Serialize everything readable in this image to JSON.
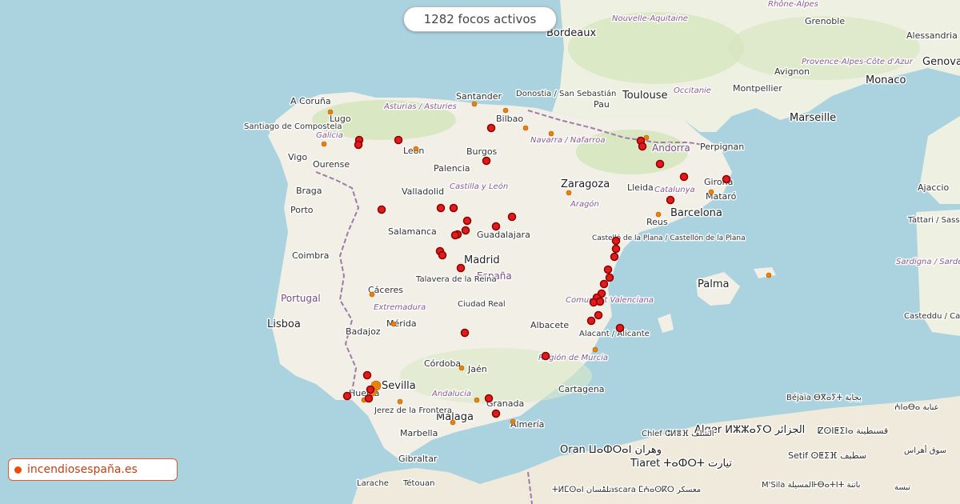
{
  "counter": {
    "text": "1282 focos activos"
  },
  "brand": {
    "label": "incendiosespaña.es",
    "color": "#f04a0a"
  },
  "colors": {
    "sea": "#aad3df",
    "land": "#f2efe9",
    "fire_fill": "#e01b1b",
    "fire_stroke": "#8b0000",
    "small_fire": "#e8820c",
    "border": "#9e7ba8"
  },
  "labels": {
    "countries": [
      {
        "id": "country-espana",
        "text": "España"
      },
      {
        "id": "country-portugal",
        "text": "Portugal"
      },
      {
        "id": "country-andorra",
        "text": "Andorra"
      }
    ],
    "regions": [
      {
        "id": "region-asturias",
        "text": "Asturias / Asturies"
      },
      {
        "id": "region-galicia",
        "text": "Galicia"
      },
      {
        "id": "region-navarra",
        "text": "Navarra / Nafarroa"
      },
      {
        "id": "region-castilla",
        "text": "Castilla y León"
      },
      {
        "id": "region-aragon",
        "text": "Aragón"
      },
      {
        "id": "region-catalunya",
        "text": "Catalunya"
      },
      {
        "id": "region-extremadura",
        "text": "Extremadura"
      },
      {
        "id": "region-comunitat",
        "text": "Comunitat Valenciana"
      },
      {
        "id": "region-murcia",
        "text": "Región de Murcia"
      },
      {
        "id": "region-andalucia",
        "text": "Andalucía"
      },
      {
        "id": "region-occitanie",
        "text": "Occitanie"
      },
      {
        "id": "region-nouvelle",
        "text": "Nouvelle-Aquitaine"
      },
      {
        "id": "region-provence",
        "text": "Provence-Alpes-Côte d'Azur"
      },
      {
        "id": "region-rhone",
        "text": "Rhône-Alpes"
      },
      {
        "id": "region-sardegna",
        "text": "Sardigna / Sardegna"
      }
    ],
    "cities": [
      {
        "id": "city-madrid",
        "text": "Madrid"
      },
      {
        "id": "city-barcelona",
        "text": "Barcelona"
      },
      {
        "id": "city-sevilla",
        "text": "Sevilla"
      },
      {
        "id": "city-malaga",
        "text": "Málaga"
      },
      {
        "id": "city-zaragoza",
        "text": "Zaragoza"
      },
      {
        "id": "city-lisboa",
        "text": "Lisboa"
      },
      {
        "id": "city-toulouse",
        "text": "Toulouse"
      },
      {
        "id": "city-bordeaux",
        "text": "Bordeaux"
      },
      {
        "id": "city-marseille",
        "text": "Marseille"
      },
      {
        "id": "city-montpellier",
        "text": "Montpellier"
      },
      {
        "id": "city-avignon",
        "text": "Avignon"
      },
      {
        "id": "city-monaco",
        "text": "Monaco"
      },
      {
        "id": "city-genova",
        "text": "Genova"
      },
      {
        "id": "city-grenoble",
        "text": "Grenoble"
      },
      {
        "id": "city-alessandria",
        "text": "Alessandria"
      },
      {
        "id": "city-pau",
        "text": "Pau"
      },
      {
        "id": "city-perpignan",
        "text": "Perpignan"
      },
      {
        "id": "city-girona",
        "text": "Girona"
      },
      {
        "id": "city-mataro",
        "text": "Mataró"
      },
      {
        "id": "city-lleida",
        "text": "Lleida"
      },
      {
        "id": "city-reus",
        "text": "Reus"
      },
      {
        "id": "city-castello",
        "text": "Castelló de la Plana / Castellón de la Plana"
      },
      {
        "id": "city-palma",
        "text": "Palma"
      },
      {
        "id": "city-alacant",
        "text": "Alacant / Alicante"
      },
      {
        "id": "city-albacete",
        "text": "Albacete"
      },
      {
        "id": "city-cartagena",
        "text": "Cartagena"
      },
      {
        "id": "city-almeria",
        "text": "Almería"
      },
      {
        "id": "city-granada",
        "text": "Granada"
      },
      {
        "id": "city-jaen",
        "text": "Jaén"
      },
      {
        "id": "city-cordoba",
        "text": "Córdoba"
      },
      {
        "id": "city-jerez",
        "text": "Jerez de la Frontera"
      },
      {
        "id": "city-huelva",
        "text": "Huelva"
      },
      {
        "id": "city-marbella",
        "text": "Marbella"
      },
      {
        "id": "city-gibraltar",
        "text": "Gibraltar"
      },
      {
        "id": "city-badajoz",
        "text": "Badajoz"
      },
      {
        "id": "city-merida",
        "text": "Mérida"
      },
      {
        "id": "city-caceres",
        "text": "Cáceres"
      },
      {
        "id": "city-ciudadreal",
        "text": "Ciudad Real"
      },
      {
        "id": "city-talavera",
        "text": "Talavera de la Reina"
      },
      {
        "id": "city-salamanca",
        "text": "Salamanca"
      },
      {
        "id": "city-guadalajara",
        "text": "Guadalajara"
      },
      {
        "id": "city-valladolid",
        "text": "Valladolid"
      },
      {
        "id": "city-palencia",
        "text": "Palencia"
      },
      {
        "id": "city-burgos",
        "text": "Burgos"
      },
      {
        "id": "city-leon",
        "text": "León"
      },
      {
        "id": "city-bilbao",
        "text": "Bilbao"
      },
      {
        "id": "city-santander",
        "text": "Santander"
      },
      {
        "id": "city-donostia",
        "text": "Donostia / San Sebastián"
      },
      {
        "id": "city-acoruna",
        "text": "A Coruña"
      },
      {
        "id": "city-santiago",
        "text": "Santiago de Compostela"
      },
      {
        "id": "city-lugo",
        "text": "Lugo"
      },
      {
        "id": "city-ourense",
        "text": "Ourense"
      },
      {
        "id": "city-vigo",
        "text": "Vigo"
      },
      {
        "id": "city-braga",
        "text": "Braga"
      },
      {
        "id": "city-porto",
        "text": "Porto"
      },
      {
        "id": "city-coimbra",
        "text": "Coimbra"
      },
      {
        "id": "city-ajaccio",
        "text": "Ajaccio"
      },
      {
        "id": "city-tattari",
        "text": "Tàttari / Sassari"
      },
      {
        "id": "city-cagliari",
        "text": "Casteddu / Cagliari"
      },
      {
        "id": "city-algiers",
        "text": "Alger ⵍⵣⵣⴰⵢⵔ الجزائر"
      },
      {
        "id": "city-oran",
        "text": "Oran ⵡⴰⵀⵔⴰⵏ وهران"
      },
      {
        "id": "city-tiaret",
        "text": "Tiaret ⵜⴰⵀⵔⵜ تيارت"
      },
      {
        "id": "city-chlef",
        "text": "Chlef ⵛⵍⴻⴼ الشلف"
      },
      {
        "id": "city-bejaia",
        "text": "Béjaïa ⴱⴳⴰⵢⵜ بجاية"
      },
      {
        "id": "city-setif",
        "text": "Setif ⵙⵟⵉⴼ سطيف"
      },
      {
        "id": "city-constantine",
        "text": "ⵇⵙⵏⵟⵉⵏⴰ قسنطينة"
      },
      {
        "id": "city-annaba",
        "text": "ⵄⵏⴰⴱⴰ عنابة"
      },
      {
        "id": "city-batna",
        "text": "ⵜⴱⴰⵜⵏⵜ باتنة"
      },
      {
        "id": "city-mascara",
        "text": "Mascara ⵎⵄⴰⵙⴽⵔ معسكر"
      },
      {
        "id": "city-tlemcen",
        "text": "ⵜⵍⵎⵙⴰⵏ تلمسان"
      },
      {
        "id": "city-larache",
        "text": "Larache"
      },
      {
        "id": "city-tetouan",
        "text": "Tétouan"
      },
      {
        "id": "city-msila",
        "text": "M'Sila المسيلة"
      },
      {
        "id": "city-soukahras",
        "text": "سوق أهراس"
      },
      {
        "id": "city-tebessa",
        "text": "تبسة"
      }
    ]
  }
}
